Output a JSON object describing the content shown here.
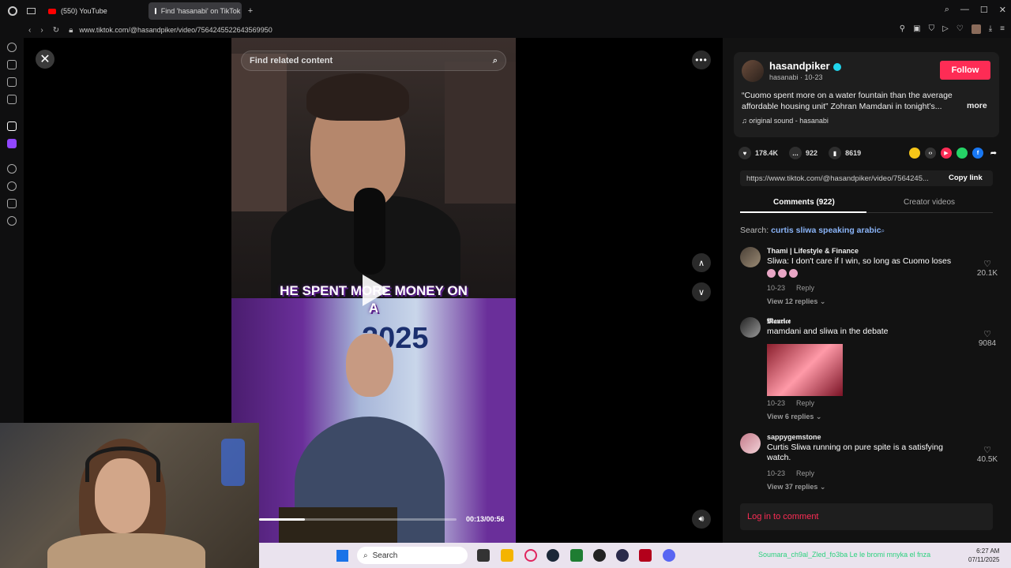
{
  "browser": {
    "tabs": [
      {
        "label": "(550) YouTube"
      },
      {
        "label": "Find 'hasanabi' on TikTok"
      }
    ],
    "new_tab": "+",
    "url": "www.tiktok.com/@hasandpiker/video/7564245522643569950"
  },
  "video": {
    "search_placeholder": "Find related content",
    "caption": "HE SPENT MORE MONEY ON A",
    "sign_text": "2025",
    "time": "00:13/00:56",
    "progress": 0.23
  },
  "post": {
    "username": "hasandpiker",
    "handle": "hasanabi · 10-23",
    "follow_label": "Follow",
    "description": "“Cuomo spent more on a water fountain than the average affordable housing unit” Zohran Mamdani in tonight’s...",
    "more_label": "more",
    "music": "original sound - hasanabi",
    "likes": "178.4K",
    "comments": "922",
    "saves": "8619",
    "link": "https://www.tiktok.com/@hasandpiker/video/7564245...",
    "copy_label": "Copy link"
  },
  "panel_tabs": {
    "comments": "Comments (922)",
    "creator": "Creator videos"
  },
  "search_hint": {
    "prefix": "Search: ",
    "query": "curtis sliwa speaking arabic"
  },
  "comments": [
    {
      "user": "Thami | Lifestyle & Finance",
      "text": "Sliwa: I don't care if I win, so long as Cuomo loses",
      "date": "10-23",
      "reply": "Reply",
      "replies": "View 12 replies",
      "likes": "20.1K"
    },
    {
      "user": "𝕸𝖆𝖚𝖗𝖎𝖈𝖊",
      "text": "mamdani and sliwa in the debate",
      "date": "10-23",
      "reply": "Reply",
      "replies": "View 6 replies",
      "likes": "9084"
    },
    {
      "user": "sappygemstone",
      "text": "Curtis Sliwa running on pure spite is a satisfying watch.",
      "date": "10-23",
      "reply": "Reply",
      "replies": "View 37 replies",
      "likes": "40.5K"
    }
  ],
  "login_label": "Log in to comment",
  "taskbar": {
    "search_label": "Search",
    "ticker": "Soumara_ch9al_Zled_fo3ba Le le bromi mnyka el fnza",
    "time": "6:27 AM",
    "date": "07/11/2025"
  },
  "colors": {
    "accent": "#fe2c55",
    "verified": "#20d5ec",
    "panel_bg": "#121212"
  }
}
